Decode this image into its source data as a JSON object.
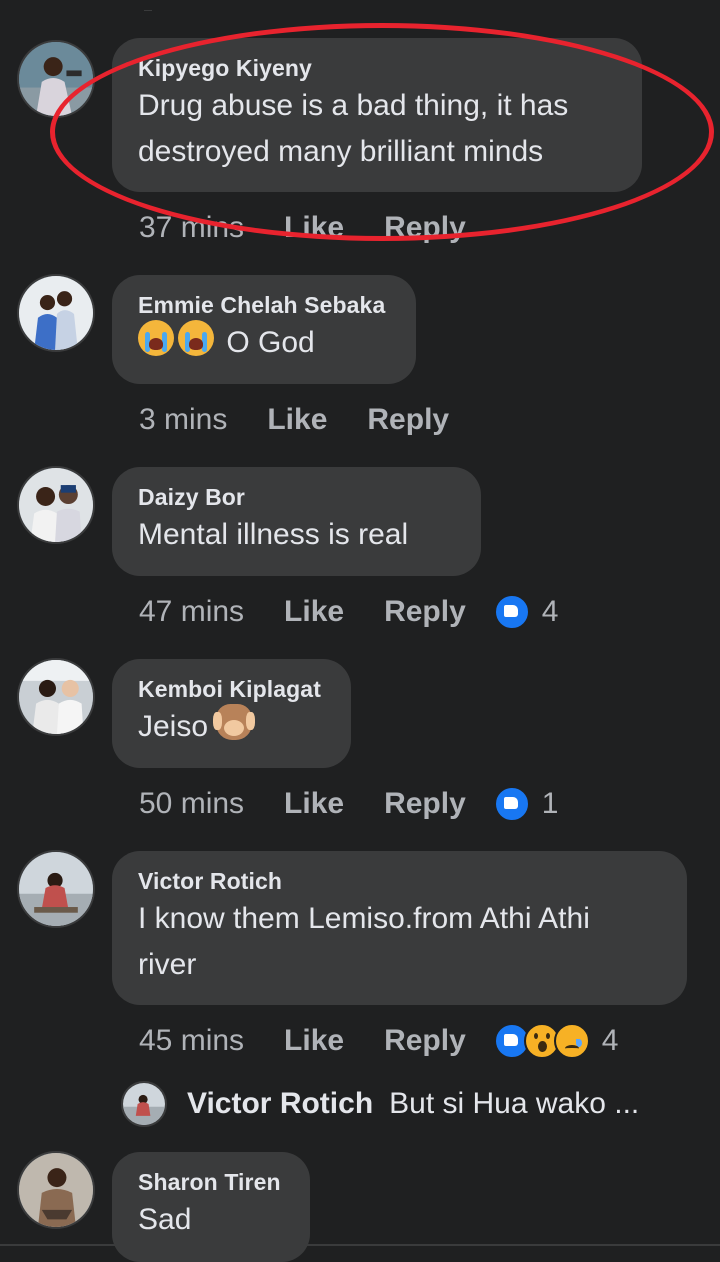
{
  "comments": [
    {
      "name": "Kipyego Kiyeny",
      "text_lines": [
        "Drug abuse is a bad thing, it has",
        "destroyed many brilliant minds"
      ],
      "time": "37 mins",
      "like": "Like",
      "reply": "Reply",
      "reaction_count": ""
    },
    {
      "name": "Emmie Chelah Sebaka",
      "text": "O God",
      "time": "3 mins",
      "like": "Like",
      "reply": "Reply",
      "reaction_count": ""
    },
    {
      "name": "Daizy Bor",
      "text": "Mental illness is real",
      "time": "47 mins",
      "like": "Like",
      "reply": "Reply",
      "reaction_count": "4"
    },
    {
      "name": "Kemboi Kiplagat",
      "text": "Jeiso",
      "time": "50 mins",
      "like": "Like",
      "reply": "Reply",
      "reaction_count": "1"
    },
    {
      "name": "Victor Rotich",
      "text_lines": [
        "I know them Lemiso.from Athi Athi",
        "river"
      ],
      "time": "45 mins",
      "like": "Like",
      "reply": "Reply",
      "reaction_count": "4"
    },
    {
      "name": "Sharon Tiren",
      "text": "Sad"
    }
  ],
  "nested_reply": {
    "name": "Victor Rotich",
    "text": "But si Hua wako ..."
  },
  "icons": {
    "like_reaction": "thumbs-up-icon",
    "wow_reaction": "wow-face-icon",
    "sad_reaction": "sad-face-icon",
    "crying_emoji": "loudly-crying-face-icon",
    "monkey_emoji": "hear-no-evil-monkey-icon"
  },
  "colors": {
    "background": "#1f2021",
    "bubble": "#3a3b3c",
    "highlight": "#e8232e",
    "like_blue": "#1877f2"
  }
}
